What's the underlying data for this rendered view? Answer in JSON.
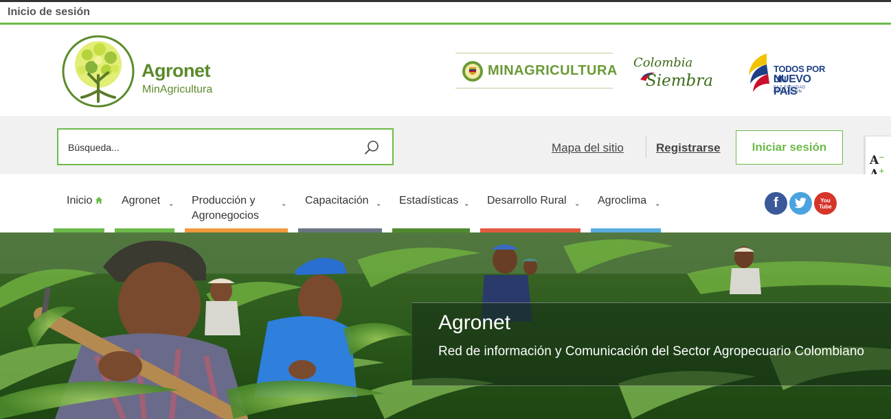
{
  "topbar": {
    "label": "Inicio de sesión"
  },
  "brand": {
    "name": "Agronet",
    "subtitle": "MinAgricultura"
  },
  "partners": {
    "minagricultura": "MINAGRICULTURA",
    "colombia_siembra": {
      "line1": "Colombia",
      "line2": "Siembra"
    },
    "todos": {
      "line1": "TODOS POR UN",
      "line2": "NUEVO PAÍS",
      "line3": "PAZ  EQUIDAD  EDUCACIÓN"
    }
  },
  "search": {
    "placeholder": "Búsqueda...",
    "value": ""
  },
  "header_links": {
    "mapa": "Mapa del sitio",
    "registro": "Registrarse",
    "login": "Iniciar sesión"
  },
  "nav": {
    "items": [
      {
        "label": "Inicio",
        "color": "#6cbb4b"
      },
      {
        "label": "Agronet",
        "color": "#6cbb4b"
      },
      {
        "label_line1": "Producción y",
        "label_line2": "Agronegocios",
        "color": "#f09a3e"
      },
      {
        "label": "Capacitación",
        "color": "#6a7582"
      },
      {
        "label": "Estadísticas",
        "color": "#4f8a2e"
      },
      {
        "label": "Desarrollo Rural",
        "color": "#e15a40"
      },
      {
        "label": "Agroclima",
        "color": "#5aace0"
      }
    ]
  },
  "social": {
    "facebook": "f",
    "twitter": "t",
    "youtube": "You Tube"
  },
  "accessibility": {
    "decrease": "A",
    "decrease_mark": "−",
    "increase": "A",
    "increase_mark": "+",
    "theme_colors": [
      "#4cb748",
      "#444444"
    ]
  },
  "hero": {
    "title": "Agronet",
    "text": "Red de información y Comunicación del Sector Agropecuario Colombiano"
  },
  "colors": {
    "accent": "#6cbb4b",
    "brand_green": "#5b8a2a"
  }
}
